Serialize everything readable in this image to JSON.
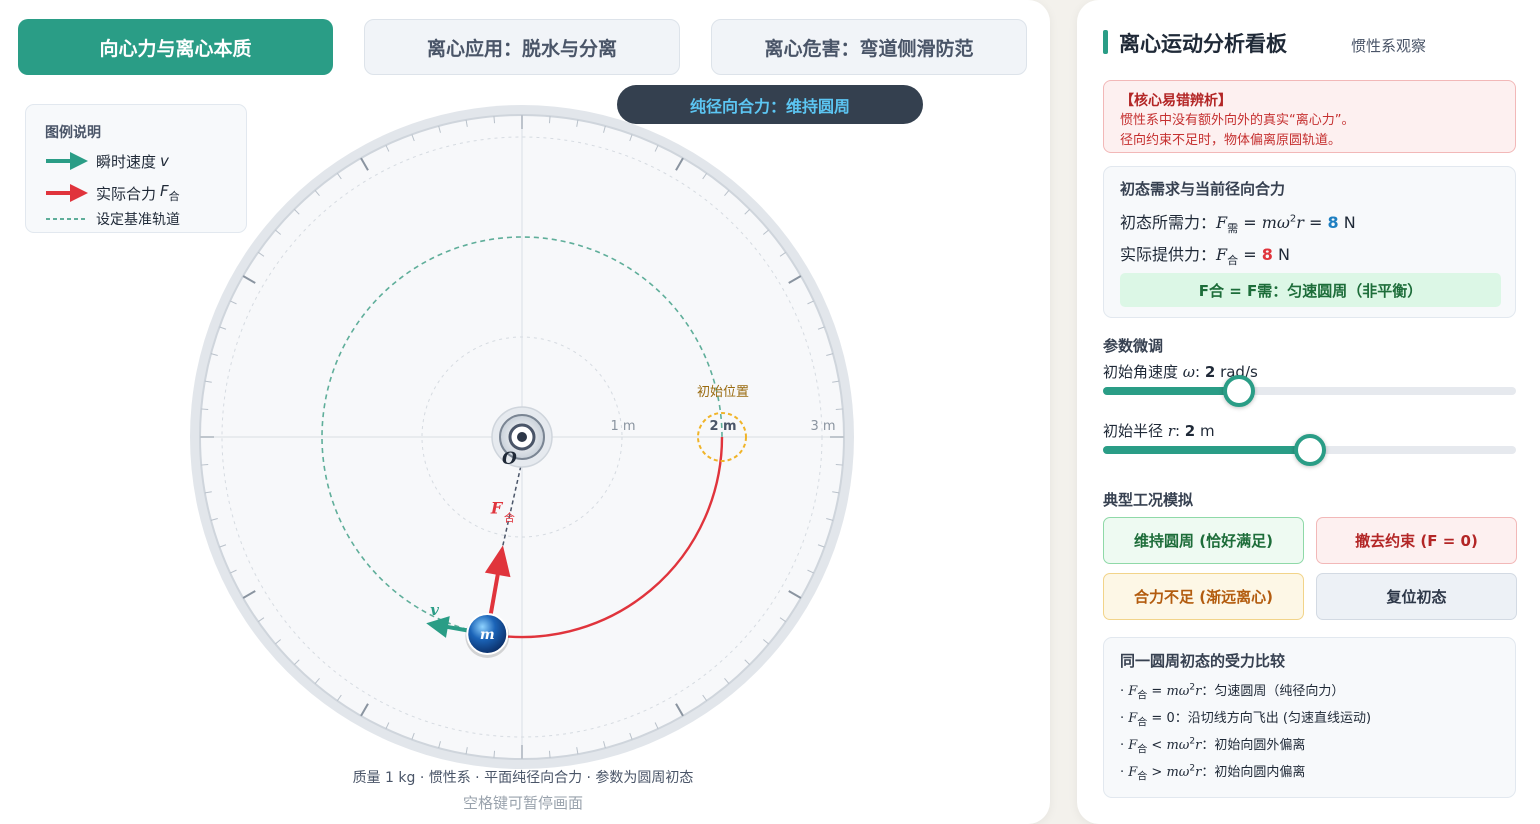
{
  "tabs": [
    {
      "label": "向心力与离心本质"
    },
    {
      "label": "离心应用：脱水与分离"
    },
    {
      "label": "离心危害：弯道侧滑防范"
    }
  ],
  "mode_pill": "纯径向合力：维持圆周",
  "legend": {
    "title": "图例说明",
    "velocity_label": "瞬时速度",
    "velocity_var": "v",
    "force_label": "实际合力",
    "force_var": "F",
    "force_sub": "合",
    "orbit_label": "设定基准轨道"
  },
  "stage": {
    "scale_labels": [
      "1 m",
      "2 m",
      "3 m"
    ],
    "start_label": "初始位置",
    "center_label": "O",
    "mass_label": "m",
    "velocity_tag": "v",
    "force_tag": "F",
    "force_tag_sub": "合",
    "orbit_radius_m": 2,
    "max_radius_m": 3,
    "mass_angle_deg": 100,
    "caption": "质量 1 kg · 惯性系 · 平面纯径向合力 · 参数为圆周初态",
    "hint": "空格键可暂停画面"
  },
  "side": {
    "title": "离心运动分析看板",
    "subtitle": "惯性系观察",
    "warning": {
      "heading": "【核心易错辨析】",
      "line1": "惯性系中没有额外向外的真实“离心力”。",
      "line2": "径向约束不足时，物体偏离原圆轨道。"
    },
    "force_card": {
      "title": "初态需求与当前径向合力",
      "required_label": "初态所需力：",
      "required_value": "8",
      "provided_label": "实际提供力：",
      "provided_value": "8",
      "unit": "N",
      "status": "F合 = F需：匀速圆周（非平衡）"
    },
    "params": {
      "title": "参数微调",
      "omega_label": "初始角速度",
      "omega_value": "2",
      "omega_unit": "rad/s",
      "omega_fraction": 0.33,
      "radius_label": "初始半径",
      "radius_value": "2",
      "radius_unit": "m",
      "radius_fraction": 0.5
    },
    "cases": {
      "title": "典型工况模拟",
      "btn_keep": "维持圆周 (恰好满足)",
      "btn_remove": "撤去约束 (F = 0)",
      "btn_insufficient": "合力不足 (渐远离心)",
      "btn_reset": "复位初态"
    },
    "compare": {
      "title": "同一圆周初态的受力比较",
      "row1_text": "：匀速圆周（纯径向力）",
      "row2_text": "：沿切线方向飞出 (匀速直线运动)",
      "row3_text": "：初始向圆外偏离",
      "row4_text": "：初始向圆内偏离"
    }
  },
  "colors": {
    "accent": "#2a9d86",
    "force": "#e0343c",
    "velocity": "#2a9d86",
    "mass_ball": "#1b64b8",
    "start_ring": "#f0b429"
  }
}
